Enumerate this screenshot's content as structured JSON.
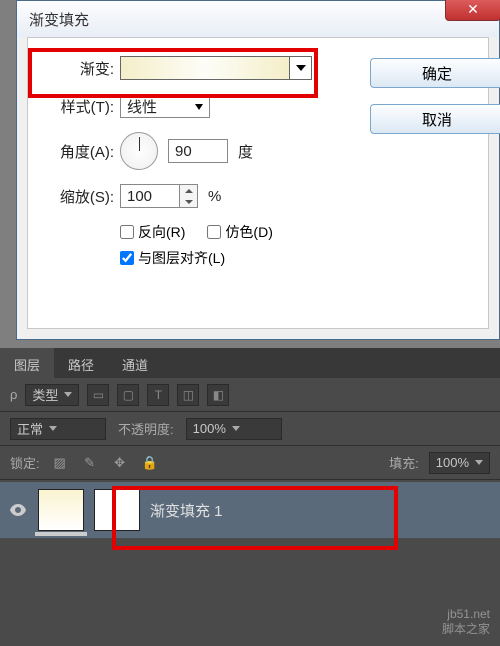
{
  "dialog": {
    "title": "渐变填充",
    "close": "✕",
    "gradient_label": "渐变:",
    "style_label": "样式(T):",
    "style_value": "线性",
    "angle_label": "角度(A):",
    "angle_value": "90",
    "angle_unit": "度",
    "scale_label": "缩放(S):",
    "scale_value": "100",
    "scale_unit": "%",
    "reverse": "反向(R)",
    "dither": "仿色(D)",
    "align": "与图层对齐(L)",
    "ok": "确定",
    "cancel": "取消"
  },
  "panel": {
    "tabs": {
      "layers": "图层",
      "paths": "路径",
      "channels": "通道"
    },
    "filter": {
      "kind": "类型",
      "icons": [
        "▭",
        "▢",
        "T",
        "◫",
        "◧"
      ]
    },
    "blend": {
      "mode": "正常",
      "opacity_label": "不透明度:",
      "opacity_value": "100%"
    },
    "lock": {
      "label": "锁定:",
      "fill_label": "填充:",
      "fill_value": "100%"
    },
    "layer": {
      "name": "渐变填充 1"
    }
  },
  "watermark": {
    "url": "jb51.net",
    "name": "脚本之家"
  }
}
